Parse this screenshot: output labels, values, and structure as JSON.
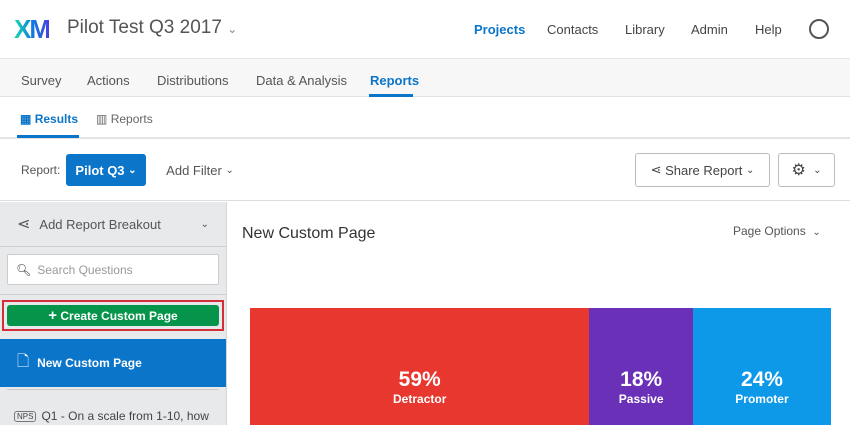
{
  "header": {
    "logo": "XM",
    "project_title": "Pilot Test Q3 2017",
    "nav": [
      "Projects",
      "Contacts",
      "Library",
      "Admin",
      "Help"
    ]
  },
  "main_tabs": [
    "Survey",
    "Actions",
    "Distributions",
    "Data & Analysis",
    "Reports"
  ],
  "sub_tabs": [
    "Results",
    "Reports"
  ],
  "toolbar": {
    "report_label": "Report:",
    "report_value": "Pilot Q3",
    "add_filter": "Add Filter",
    "share_report": "Share Report"
  },
  "sidebar": {
    "breakout": "Add Report Breakout",
    "search_placeholder": "Search Questions",
    "create_button": "Create Custom Page",
    "active_page": "New Custom Page",
    "question_badge": "NPS",
    "question": "Q1 - On a scale from 1-10, how"
  },
  "page": {
    "title": "New Custom Page",
    "options": "Page Options"
  },
  "chart_data": {
    "type": "bar",
    "orientation": "stacked-horizontal",
    "categories": [
      "Detractor",
      "Passive",
      "Promoter"
    ],
    "values": [
      59,
      18,
      24
    ],
    "labels": [
      "59%",
      "18%",
      "24%"
    ],
    "colors": [
      "#e7372f",
      "#6a31b8",
      "#0d98e8"
    ]
  }
}
